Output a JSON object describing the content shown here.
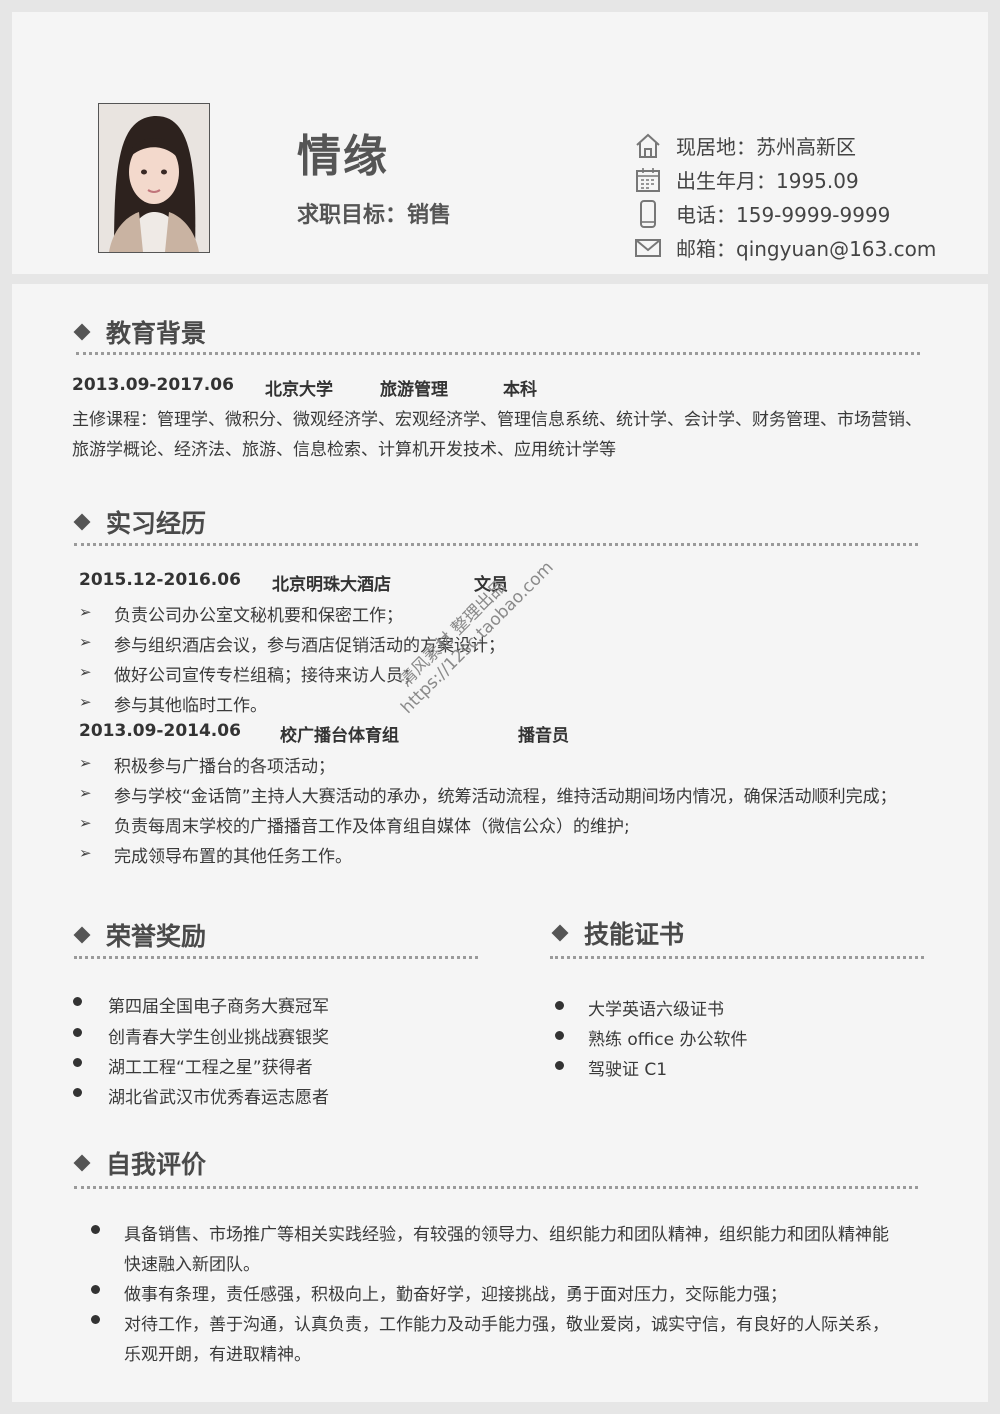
{
  "header": {
    "name": "情缘",
    "objective": "求职目标：销售",
    "contacts": [
      {
        "icon": "home-icon",
        "text": "现居地：苏州高新区"
      },
      {
        "icon": "calendar-icon",
        "text": "出生年月：1995.09"
      },
      {
        "icon": "phone-icon",
        "text": "电话：159-9999-9999"
      },
      {
        "icon": "mail-icon",
        "text": "邮箱：qingyuan@163.com"
      }
    ]
  },
  "education": {
    "title": "教育背景",
    "period": "2013.09-2017.06",
    "school": "北京大学",
    "major": "旅游管理",
    "degree": "本科",
    "courses_line1": "主修课程：管理学、微积分、微观经济学、宏观经济学、管理信息系统、统计学、会计学、财务管理、市场营销、",
    "courses_line2": "旅游学概论、经济法、旅游、信息检索、计算机开发技术、应用统计学等"
  },
  "internship": {
    "title": "实习经历",
    "jobs": [
      {
        "period": "2015.12-2016.06",
        "org": "北京明珠大酒店",
        "role": "文员",
        "items": [
          "负责公司办公室文秘机要和保密工作；",
          "参与组织酒店会议，参与酒店促销活动的方案设计；",
          "做好公司宣传专栏组稿；接待来访人员；",
          "参与其他临时工作。"
        ]
      },
      {
        "period": "2013.09-2014.06",
        "org": "校广播台体育组",
        "role": "播音员",
        "items": [
          "积极参与广播台的各项活动；",
          "参与学校“金话筒”主持人大赛活动的承办，统筹活动流程，维持活动期间场内情况，确保活动顺利完成；",
          "负责每周末学校的广播播音工作及体育组自媒体（微信公众）的维护;",
          "完成领导布置的其他任务工作。"
        ]
      }
    ],
    "arrow_glyph": "➢"
  },
  "honors": {
    "title": "荣誉奖励",
    "items": [
      "第四届全国电子商务大赛冠军",
      "创青春大学生创业挑战赛银奖",
      "湖工工程“工程之星”获得者",
      "湖北省武汉市优秀春运志愿者"
    ]
  },
  "skills": {
    "title": "技能证书",
    "items": [
      "大学英语六级证书",
      "熟练 office 办公软件",
      "驾驶证 C1"
    ]
  },
  "self_eval": {
    "title": "自我评价",
    "lines": [
      "具备销售、市场推广等相关实践经验，有较强的领导力、组织能力和团队精神，组织能力和团队精神能",
      "快速融入新团队。",
      "做事有条理，责任感强，积极向上，勤奋好学，迎接挑战，勇于面对压力，交际能力强；",
      "对待工作，善于沟通，认真负责，工作能力及动手能力强，敬业爱岗，诚实守信，有良好的人际关系，",
      "乐观开朗，有进取精神。"
    ]
  },
  "watermark": {
    "line1": "清风素材 整理出品",
    "line2": "https://12sc.taobao.com"
  },
  "colors": {
    "background": "#e6e6e6",
    "card": "#f5f5f5",
    "text": "#3a3a3a",
    "heading": "#555555"
  }
}
